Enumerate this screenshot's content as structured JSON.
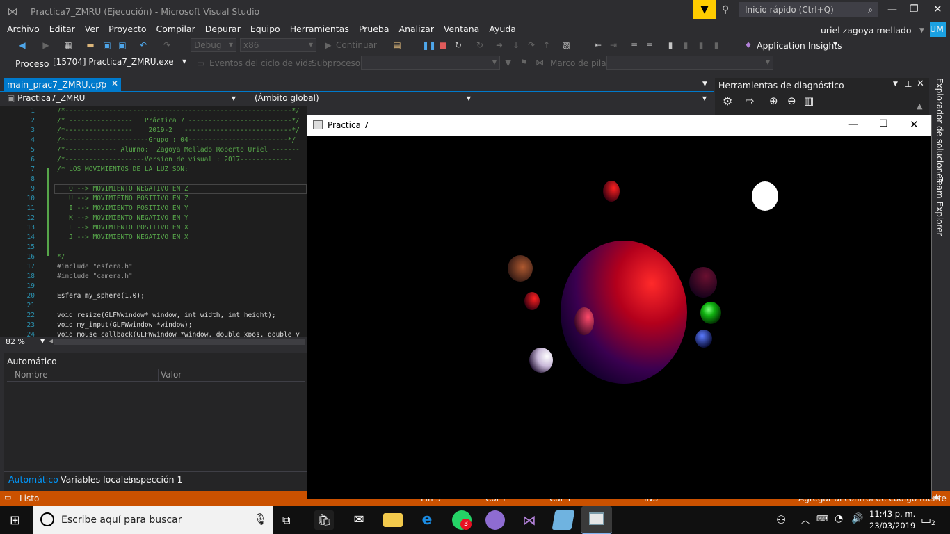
{
  "window": {
    "title": "Practica7_ZMRU (Ejecución) - Microsoft Visual Studio",
    "quick_launch": "Inicio rápido (Ctrl+Q)",
    "user": "uriel zagoya mellado",
    "initials": "UM"
  },
  "menu": [
    "Archivo",
    "Editar",
    "Ver",
    "Proyecto",
    "Compilar",
    "Depurar",
    "Equipo",
    "Herramientas",
    "Prueba",
    "Analizar",
    "Ventana",
    "Ayuda"
  ],
  "toolbar": {
    "config": "Debug",
    "platform": "x86",
    "continue": "Continuar",
    "app_insights": "Application Insights"
  },
  "toolbar2": {
    "process_label": "Proceso:",
    "process": "[15704] Practica7_ZMRU.exe",
    "lifecycle": "Eventos del ciclo de vida",
    "subprocess": "Subproceso:",
    "stack_label": "Marco de pila:"
  },
  "editor": {
    "tab": "main_prac7_ZMRU.cpp",
    "project": "Practica7_ZMRU",
    "scope": "(Ámbito global)",
    "zoom": "82 %",
    "lines": [
      {
        "n": "1",
        "t": "/*---------------------------------------------------------*/"
      },
      {
        "n": "2",
        "t": "/* ----------------   Práctica 7 --------------------------*/"
      },
      {
        "n": "3",
        "t": "/*-----------------    2019-2   ---------------------------*/"
      },
      {
        "n": "4",
        "t": "/*---------------------Grupo : 04-------------------------*/"
      },
      {
        "n": "5",
        "t": "/*------------- Alumno:  Zagoya Mellado Roberto Uriel -------"
      },
      {
        "n": "6",
        "t": "/*--------------------Version de visual : 2017-------------"
      },
      {
        "n": "7",
        "t": "/* LOS MOVIMIENTOS DE LA LUZ SON:"
      },
      {
        "n": "8",
        "t": ""
      },
      {
        "n": "9",
        "t": "   O --> MOVIMIENTO NEGATIVO EN Z"
      },
      {
        "n": "10",
        "t": "   U --> MOVIMIETNO POSITIVO EN Z"
      },
      {
        "n": "11",
        "t": "   I --> MOVIMIENTO POSITIVO EN Y"
      },
      {
        "n": "12",
        "t": "   K --> MOVIMIENTO NEGATIVO EN Y"
      },
      {
        "n": "13",
        "t": "   L --> MOVIMIENTO POSITIVO EN X"
      },
      {
        "n": "14",
        "t": "   J --> MOVIMIENTO NEGATIVO EN X"
      },
      {
        "n": "15",
        "t": ""
      },
      {
        "n": "16",
        "t": "*/"
      },
      {
        "n": "17",
        "t": "#include \"esfera.h\""
      },
      {
        "n": "18",
        "t": "#include \"camera.h\""
      },
      {
        "n": "19",
        "t": ""
      },
      {
        "n": "20",
        "t": "Esfera my_sphere(1.0);"
      },
      {
        "n": "21",
        "t": ""
      },
      {
        "n": "22",
        "t": "void resize(GLFWwindow* window, int width, int height);"
      },
      {
        "n": "23",
        "t": "void my_input(GLFWwindow *window);"
      },
      {
        "n": "24",
        "t": "void mouse_callback(GLFWwindow *window, double xpos, double y"
      }
    ]
  },
  "diag": {
    "title": "Herramientas de diagnóstico"
  },
  "side": {
    "solutions": "Explorador de soluciones",
    "team": "Team Explorer"
  },
  "auto": {
    "title": "Automático",
    "col_name": "Nombre",
    "col_value": "Valor",
    "tabs": [
      "Automático",
      "Variables locales",
      "Inspección 1"
    ]
  },
  "status": {
    "text": "Listo",
    "ln": "Lín 9",
    "col": "Col 1",
    "car": "Car 1",
    "ins": "INS",
    "source": "Agregar al control de código fuente"
  },
  "app": {
    "title": "Practica 7"
  },
  "taskbar": {
    "search": "Escribe aquí para buscar",
    "time": "11:43 p. m.",
    "date": "23/03/2019",
    "badge": "3",
    "notif": "2"
  }
}
